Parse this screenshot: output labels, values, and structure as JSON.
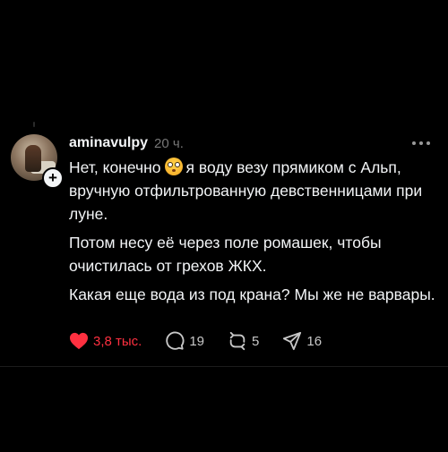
{
  "post": {
    "username": "aminavulpy",
    "time": "20 ч.",
    "text_line1_before_emoji": "Нет, конечно",
    "text_line1_after_emoji": "я воду везу прямиком с Альп, вручную отфильтрованную девственницами при луне.",
    "paragraph2": "Потом несу её через поле ромашек, чтобы очистилась от грехов ЖКХ.",
    "paragraph3": "Какая еще вода из под крана? Мы же не варвары."
  },
  "actions": {
    "likes": "3,8 тыс.",
    "comments": "19",
    "reposts": "5",
    "shares": "16"
  },
  "colors": {
    "background": "#000000",
    "text": "#f3f5f7",
    "muted": "#777777",
    "like_red": "#ff3040"
  },
  "icons": [
    "heart-icon",
    "comment-icon",
    "repost-icon",
    "share-icon",
    "more-icon",
    "follow-plus-icon",
    "emoji-flushed-icon"
  ]
}
